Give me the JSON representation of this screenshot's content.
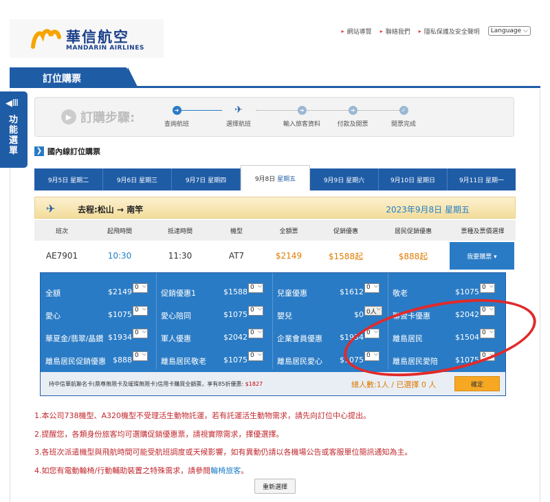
{
  "header": {
    "logo_cn": "華信航空",
    "logo_en": "MANDARIN AIRLINES",
    "links": [
      "網站導覽",
      "聯絡我們",
      "隱私保護及安全聲明"
    ],
    "language": "Language"
  },
  "band": {
    "title": "訂位購票"
  },
  "side": {
    "label": "功能選單"
  },
  "steps": {
    "title": "訂購步驟:",
    "items": [
      "查詢航班",
      "選擇航班",
      "輸入旅客資料",
      "付款及開票",
      "開票完成"
    ]
  },
  "section": {
    "title": "國內線訂位購票"
  },
  "dates": [
    {
      "d": "9月5日",
      "w": "星期二"
    },
    {
      "d": "9月6日",
      "w": "星期三"
    },
    {
      "d": "9月7日",
      "w": "星期四"
    },
    {
      "d": "9月8日",
      "w": "星期五"
    },
    {
      "d": "9月9日",
      "w": "星期六"
    },
    {
      "d": "9月10日",
      "w": "星期日"
    },
    {
      "d": "9月11日",
      "w": "星期一"
    }
  ],
  "route": {
    "text": "去程:松山 → 南竿",
    "date": "2023年9月8日 星期五"
  },
  "columns": [
    "班次",
    "起飛時間",
    "抵達時間",
    "機型",
    "全額票",
    "促銷優惠",
    "居民促銷優惠",
    "票種及票價選擇"
  ],
  "flight": {
    "no": "AE7901",
    "dep": "10:30",
    "arr": "11:30",
    "type": "AT7",
    "full": "$2149",
    "promo": "$1588起",
    "resident": "$888起",
    "buy": "我要購票 ▾"
  },
  "fares": [
    [
      "全額",
      "$2149",
      "0"
    ],
    [
      "促銷優惠1",
      "$1588",
      "0"
    ],
    [
      "兒童優惠",
      "$1612",
      "0"
    ],
    [
      "敬老",
      "$1075",
      "0"
    ],
    [
      "愛心",
      "$1075",
      "0"
    ],
    [
      "愛心陪同",
      "$1075",
      "0"
    ],
    [
      "嬰兒",
      "$0",
      "0人"
    ],
    [
      "聯營卡優惠",
      "$2042",
      "0"
    ],
    [
      "華夏金/翡翠/晶鑽",
      "$1934",
      "0"
    ],
    [
      "軍人優惠",
      "$2042",
      "0"
    ],
    [
      "企業會員優惠",
      "$1934",
      "0"
    ],
    [
      "離島居民",
      "$1504",
      "0"
    ],
    [
      "離島居民促銷優惠",
      "$888",
      "0"
    ],
    [
      "離島居民敬老",
      "$1075",
      "0"
    ],
    [
      "離島居民愛心",
      "$1075",
      "0"
    ],
    [
      "離島居民愛陪",
      "$1075",
      "0"
    ]
  ],
  "panel": {
    "card_note": "持中信華航聯名卡(鼎尊無限卡及璀璨無限卡)信用卡購買全額票，享有85折優惠:",
    "card_price": "$1827",
    "count": "總人數:1人 / 已選擇 0 人",
    "confirm": "確定"
  },
  "notes": [
    "1.本公司738機型、A320機型不受理活生動物託運，若有託運活生動物需求，請先向訂位中心提出。",
    "2.提醒您，各類身份旅客均可選購促銷優惠票，請視實際需求，擇優選擇。",
    "3.各班次派遣機型與飛航時間可能受航班調度或天候影響，如有異動仍請以各機場公告或客服單位簡訊通知為主。"
  ],
  "note4_pre": "4.如您有電動輪椅/行動輔助裝置之特殊需求，請參閱",
  "note4_link": "輪椅旅客",
  "note4_post": "。",
  "reset": "重新選擇"
}
